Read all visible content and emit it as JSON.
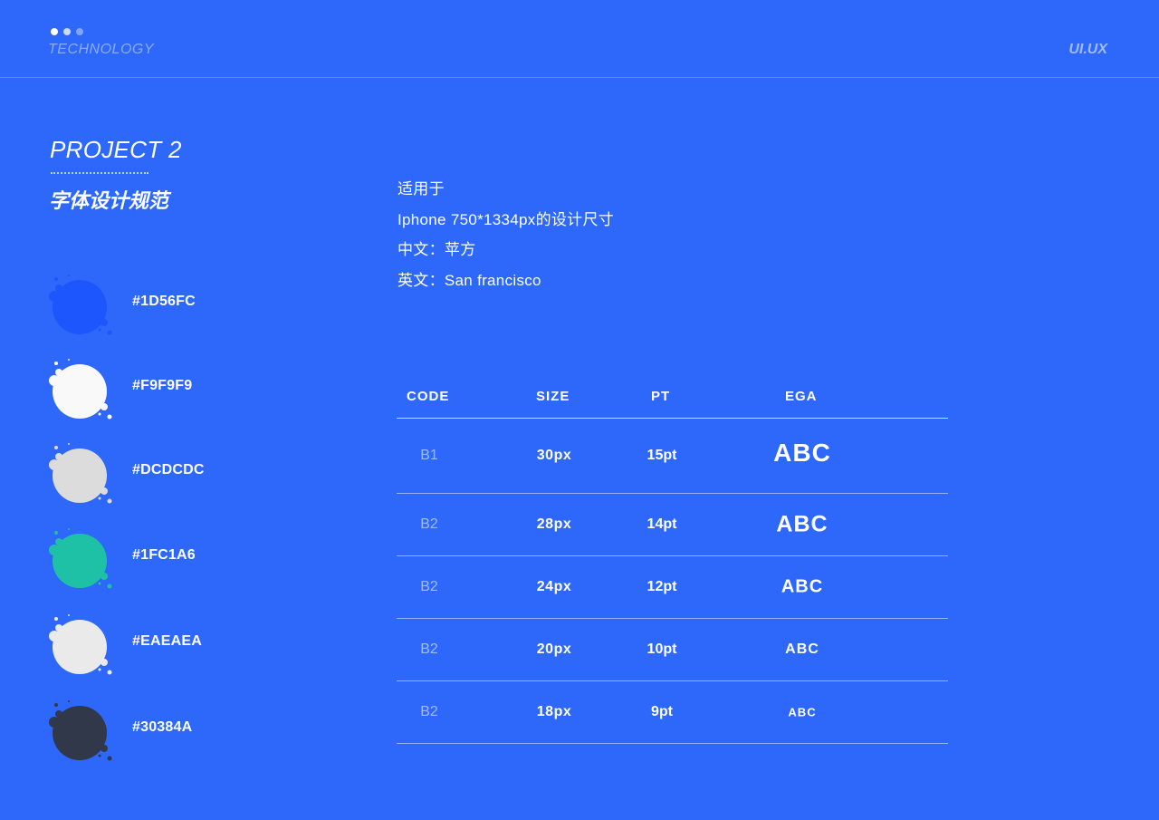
{
  "header": {
    "brand": "TECHNOLOGY",
    "tag": "UI.UX"
  },
  "project": {
    "title": "PROJECT 2",
    "subtitle": "字体设计规范"
  },
  "swatches": [
    {
      "hex": "#1D56FC",
      "color": "#1D56FC"
    },
    {
      "hex": "#F9F9F9",
      "color": "#F9F9F9"
    },
    {
      "hex": "#DCDCDC",
      "color": "#DCDCDC"
    },
    {
      "hex": "#1FC1A6",
      "color": "#1FC1A6"
    },
    {
      "hex": "#EAEAEA",
      "color": "#EAEAEA"
    },
    {
      "hex": "#30384A",
      "color": "#30384A"
    }
  ],
  "info": {
    "line1": "适用于",
    "line2": "Iphone 750*1334px的设计尺寸",
    "line3": "中文：苹方",
    "line4": "英文：San francisco"
  },
  "table": {
    "headers": {
      "code": "CODE",
      "size": "SIZE",
      "pt": "PT",
      "ega": "EGA"
    },
    "rows": [
      {
        "code": "B1",
        "size": "30px",
        "pt": "15pt",
        "ega": "ABC"
      },
      {
        "code": "B2",
        "size": "28px",
        "pt": "14pt",
        "ega": "ABC"
      },
      {
        "code": "B2",
        "size": "24px",
        "pt": "12pt",
        "ega": "ABC"
      },
      {
        "code": "B2",
        "size": "20px",
        "pt": "10pt",
        "ega": "ABC"
      },
      {
        "code": "B2",
        "size": "18px",
        "pt": "9pt",
        "ega": "ABC"
      }
    ]
  },
  "colors": {
    "background": "#2D68FB"
  }
}
